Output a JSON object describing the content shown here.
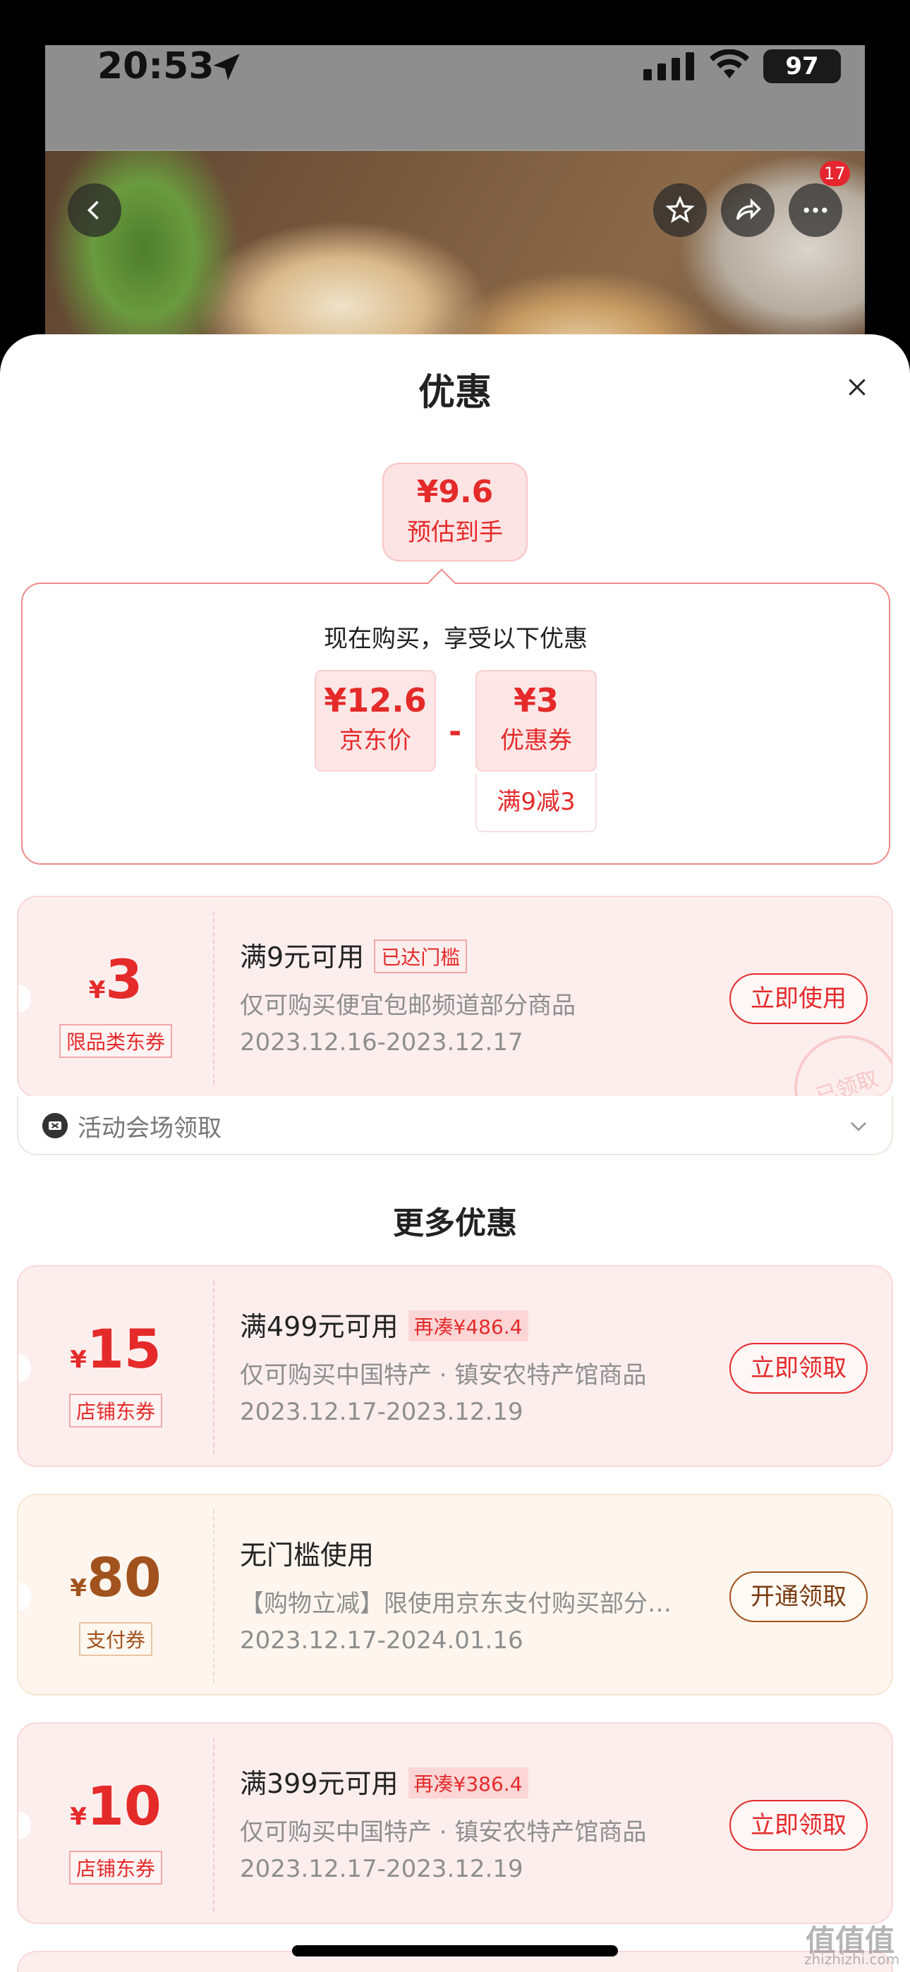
{
  "status_bar": {
    "time": "20:53",
    "battery": "97"
  },
  "header": {
    "badge_count": "17"
  },
  "sheet": {
    "title": "优惠",
    "estimate": {
      "price": "¥9.6",
      "label": "预估到手"
    },
    "calc": {
      "heading": "现在购买，享受以下优惠",
      "jd_price": {
        "value": "¥12.6",
        "label": "京东价"
      },
      "operator": "-",
      "coupon": {
        "value": "¥3",
        "label": "优惠券",
        "condition": "满9减3"
      }
    },
    "current_coupon": {
      "yen": "¥",
      "amount": "3",
      "type": "限品类东券",
      "title": "满9元可用",
      "tag": "已达门槛",
      "desc": "仅可购买便宜包邮频道部分商品",
      "date": "2023.12.16-2023.12.17",
      "button": "立即使用",
      "stamp": "已领取"
    },
    "venue": {
      "label": "活动会场领取"
    },
    "more_title": "更多优惠",
    "more_coupons": [
      {
        "yen": "¥",
        "amount": "15",
        "type": "店铺东券",
        "title": "满499元可用",
        "tag": "再凑¥486.4",
        "desc": "仅可购买中国特产 · 镇安农特产馆商品",
        "date": "2023.12.17-2023.12.19",
        "button": "立即领取"
      },
      {
        "yen": "¥",
        "amount": "80",
        "type": "支付券",
        "title": "无门槛使用",
        "tag": "",
        "desc": "【购物立减】限使用京东支付购买部分…",
        "date": "2023.12.17-2024.01.16",
        "button": "开通领取"
      },
      {
        "yen": "¥",
        "amount": "10",
        "type": "店铺东券",
        "title": "满399元可用",
        "tag": "再凑¥386.4",
        "desc": "仅可购买中国特产 · 镇安农特产馆商品",
        "date": "2023.12.17-2023.12.19",
        "button": "立即领取"
      }
    ]
  },
  "watermark": {
    "main": "值值值",
    "sub": "zhizhizhi.com"
  },
  "icons": [
    "location-arrow-icon",
    "signal-icon",
    "wifi-icon",
    "back-icon",
    "star-icon",
    "share-icon",
    "more-icon",
    "close-icon",
    "ticket-icon",
    "chevron-down-icon"
  ],
  "colors": {
    "accent": "#e52a2a",
    "gold": "#a2521d"
  }
}
